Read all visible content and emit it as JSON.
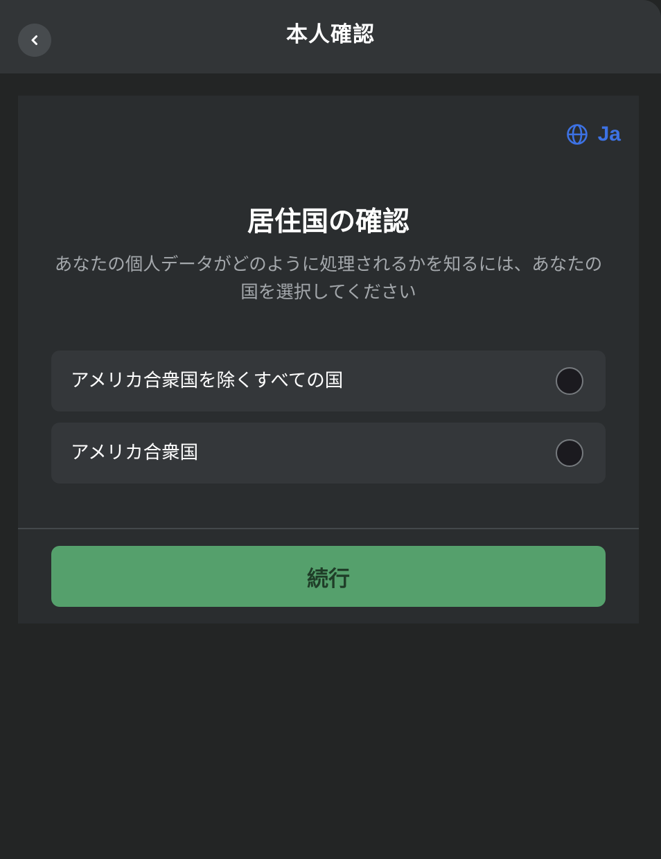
{
  "header": {
    "title": "本人確認",
    "back_icon": "chevron-left-icon"
  },
  "language": {
    "icon": "globe-icon",
    "label": "Ja",
    "color": "#3d72e4"
  },
  "main": {
    "title": "居住国の確認",
    "description": "あなたの個人データがどのように処理されるかを知るには、あなたの国を選択してください"
  },
  "options": [
    {
      "label": "アメリカ合衆国を除くすべての国",
      "selected": false
    },
    {
      "label": "アメリカ合衆国",
      "selected": false
    }
  ],
  "footer": {
    "continue_label": "続行",
    "button_color": "#55a06c"
  }
}
